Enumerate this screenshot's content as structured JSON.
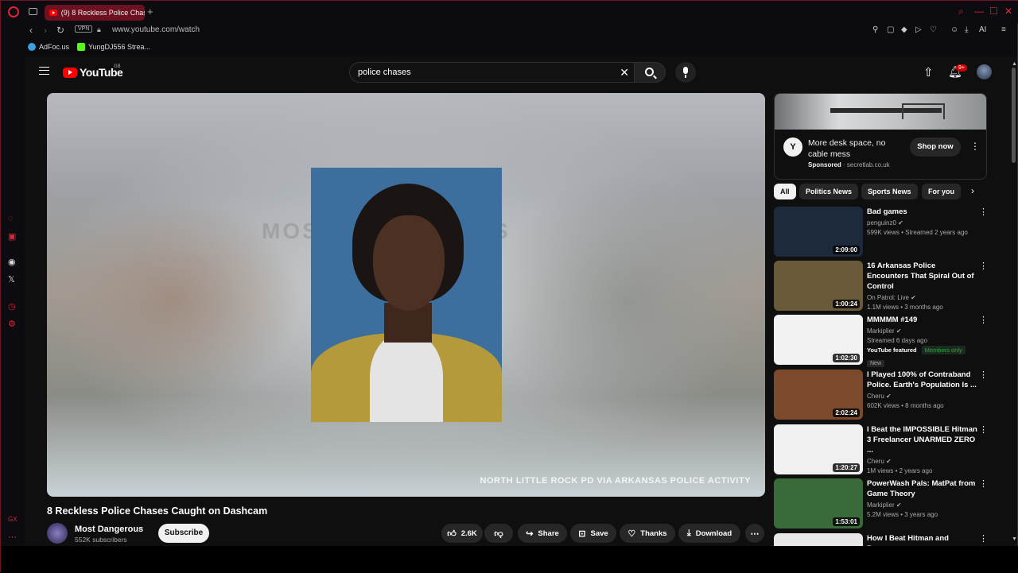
{
  "browser": {
    "tab_title": "(9) 8 Reckless Police Chas",
    "url": "www.youtube.com/watch",
    "vpn_label": "VPN",
    "ai_label": "AI",
    "bookmarks": [
      "AdFoc.us",
      "YungDJ556 Strea..."
    ]
  },
  "header": {
    "logo_text": "YouTube",
    "country_code": "GB",
    "search_value": "police chases",
    "notification_count": "9+"
  },
  "video": {
    "overlay_credit": "NORTH LITTLE ROCK PD VIA ARKANSAS POLICE ACTIVITY",
    "watermark": "MOST DANGEROUS",
    "title": "8 Reckless Police Chases Caught on Dashcam",
    "channel": "Most Dangerous",
    "subscribers": "552K subscribers",
    "subscribe_label": "Subscribe",
    "likes": "2.6K",
    "share_label": "Share",
    "save_label": "Save",
    "thanks_label": "Thanks",
    "download_label": "Download"
  },
  "ad": {
    "logo_letter": "Y",
    "text": "More desk space, no cable mess",
    "sponsored_label": "Sponsored",
    "domain": "secretlab.co.uk",
    "cta": "Shop now"
  },
  "chips": [
    "All",
    "Politics News",
    "Sports News",
    "For you"
  ],
  "recommendations": [
    {
      "title": "Bad games",
      "channel": "penguinz0",
      "meta": "599K views • Streamed 2 years ago",
      "duration": "2:09:00",
      "color": "#1c2a3c"
    },
    {
      "title": "16 Arkansas Police Encounters That Spiral Out of Control",
      "channel": "On Patrol: Live",
      "meta": "1.1M views • 3 months ago",
      "duration": "1:00:24",
      "color": "#6b5a3a"
    },
    {
      "title": "MMMMM #149",
      "channel": "Markiplier",
      "meta": "Streamed 6 days ago",
      "duration": "1:02:30",
      "color": "#f2f2f2",
      "featured": "YouTube featured",
      "members": "Members only",
      "new": "New"
    },
    {
      "title": "I Played 100% of Contraband Police. Earth's Population Is ...",
      "channel": "Cheru",
      "meta": "602K views • 8 months ago",
      "duration": "2:02:24",
      "color": "#7a4a2a"
    },
    {
      "title": "I Beat the IMPOSSIBLE Hitman 3 Freelancer UNARMED ZERO ...",
      "channel": "Cheru",
      "meta": "1M views • 2 years ago",
      "duration": "1:20:27",
      "color": "#f0f0f0"
    },
    {
      "title": "PowerWash Pals: MatPat from Game Theory",
      "channel": "Markiplier",
      "meta": "5.2M views • 3 years ago",
      "duration": "1:53:01",
      "color": "#3a6a3a"
    },
    {
      "title": "How I Beat Hitman and Became",
      "channel": "",
      "meta": "",
      "duration": "",
      "color": "#e8e8e8"
    }
  ]
}
